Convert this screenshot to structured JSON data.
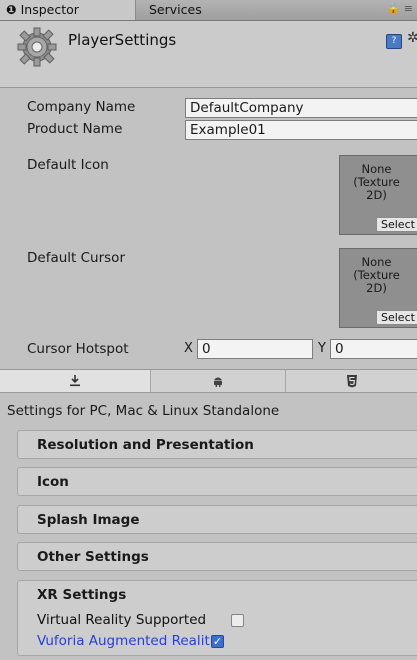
{
  "tabs": {
    "inspector": "Inspector",
    "services": "Services",
    "info_glyph": "❶",
    "lock_glyph": "🔒 ≡"
  },
  "header": {
    "title": "PlayerSettings"
  },
  "fields": {
    "company_label": "Company Name",
    "company_value": "DefaultCompany",
    "product_label": "Product Name",
    "product_value": "Example01",
    "default_icon_label": "Default Icon",
    "default_cursor_label": "Default Cursor",
    "texture_none_line1": "None",
    "texture_none_line2": "(Texture",
    "texture_none_line3": "2D)",
    "select_label": "Select",
    "cursor_hotspot_label": "Cursor Hotspot",
    "hotspot_x_label": "X",
    "hotspot_x_value": "0",
    "hotspot_y_label": "Y",
    "hotspot_y_value": "0"
  },
  "platform_tabs": [
    {
      "icon": "download-icon",
      "glyph": "⭳",
      "selected": true
    },
    {
      "icon": "android-icon",
      "glyph": "✱",
      "selected": false
    },
    {
      "icon": "html5-icon",
      "glyph": "5",
      "selected": false
    }
  ],
  "settings_for": "Settings for PC, Mac & Linux Standalone",
  "sections": [
    "Resolution and Presentation",
    "Icon",
    "Splash Image",
    "Other Settings"
  ],
  "xr": {
    "title": "XR Settings",
    "virtual_reality_label": "Virtual Reality Supported",
    "virtual_reality_checked": false,
    "vuforia_label": "Vuforia Augmented Realit",
    "vuforia_checked": true
  },
  "colors": {
    "accent_blue": "#2241d8",
    "checkbox_blue": "#3b6fd1"
  }
}
